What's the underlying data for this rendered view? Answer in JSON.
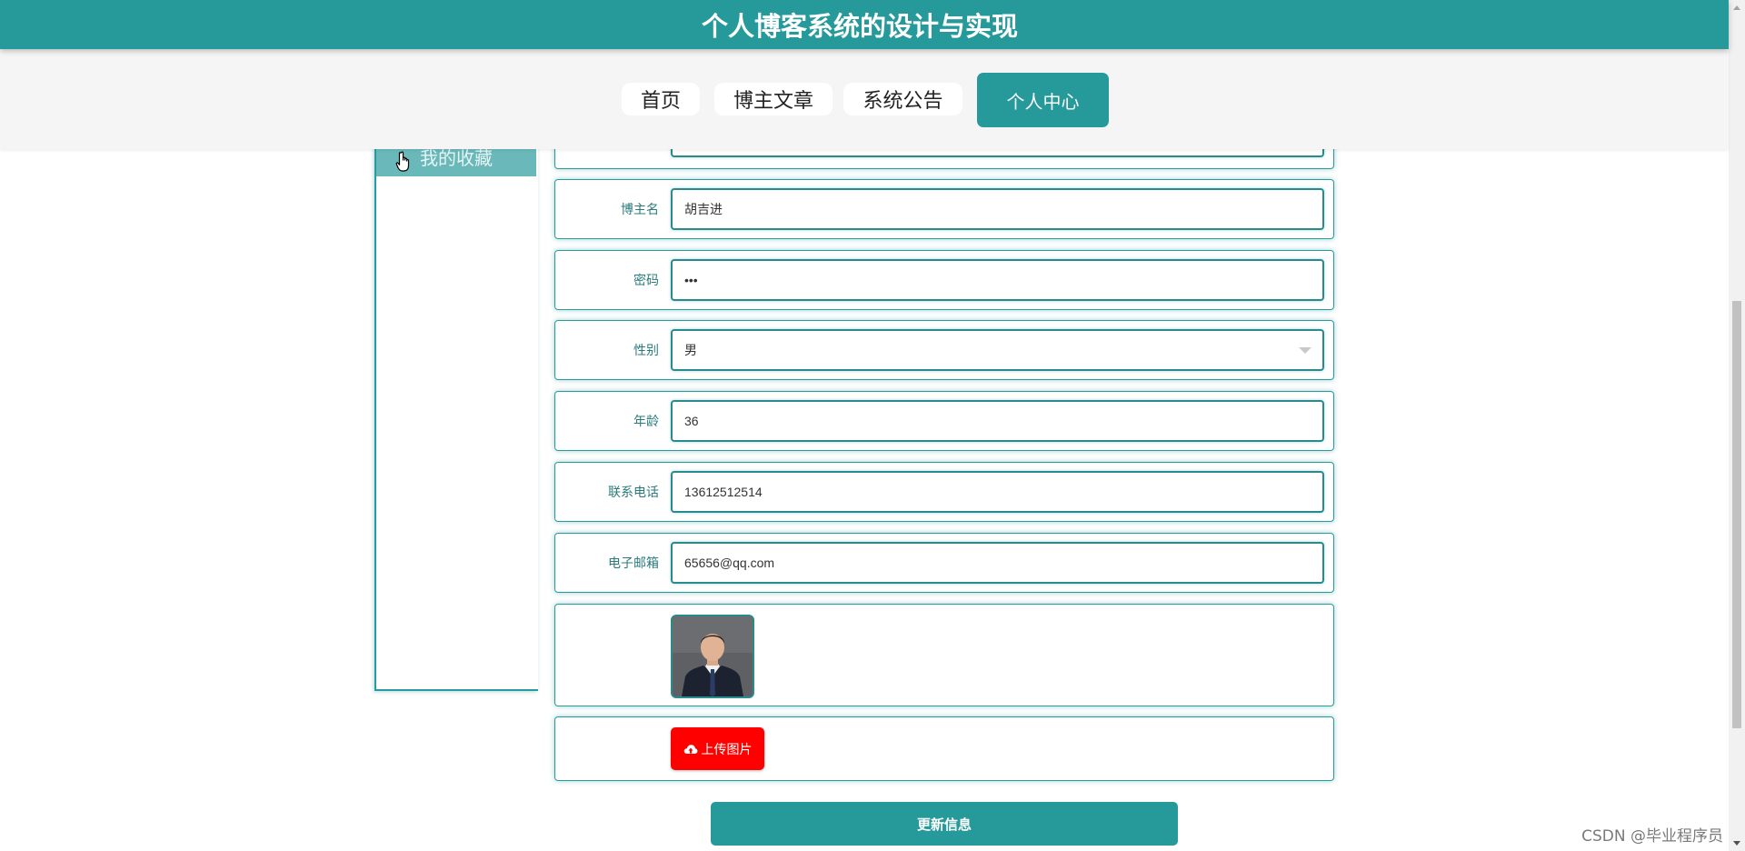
{
  "header": {
    "title": "个人博客系统的设计与实现"
  },
  "nav": {
    "items": [
      "首页",
      "博主文章",
      "系统公告",
      "个人中心"
    ]
  },
  "sidebar": {
    "items": [
      {
        "label": "我的收藏"
      }
    ]
  },
  "form": {
    "fields": {
      "blogger_name": {
        "label": "博主名",
        "value": "胡吉进"
      },
      "password": {
        "label": "密码",
        "value": "•••"
      },
      "gender": {
        "label": "性别",
        "value": "男"
      },
      "age": {
        "label": "年龄",
        "value": "36"
      },
      "phone": {
        "label": "联系电话",
        "value": "13612512514"
      },
      "email": {
        "label": "电子邮箱",
        "value": "65656@qq.com"
      }
    },
    "upload_label": "上传图片",
    "submit_label": "更新信息"
  },
  "watermark": "CSDN @毕业程序员",
  "colors": {
    "primary": "#26999a",
    "upload": "#ff0000",
    "nav_bg": "#f5f5f5"
  }
}
